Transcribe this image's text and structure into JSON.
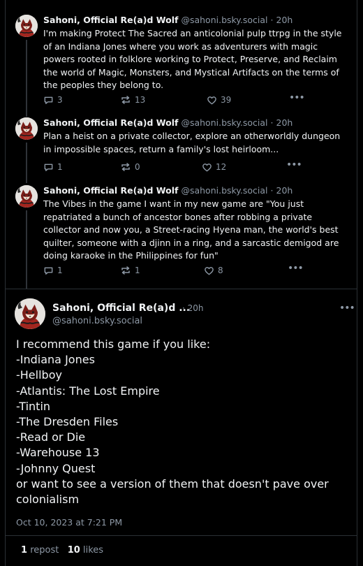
{
  "theme": {
    "background": "#000000",
    "text_primary": "#f1f3f5",
    "text_secondary": "#8d98a5",
    "divider": "#2b3035"
  },
  "thread": [
    {
      "author_name": "Sahoni, Official Re(a)d Wolf",
      "handle": "@sahoni.bsky.social",
      "separator": "·",
      "time": "20h",
      "text": "I'm making Protect The Sacred an anticolonial pulp ttrpg in the style of an Indiana Jones where you work as adventurers with magic powers rooted in folklore working to Protect, Preserve, and Reclaim the world of Magic, Monsters, and Mystical Artifacts on the terms of the peoples they belong to.",
      "replies": "3",
      "reposts": "13",
      "likes": "39"
    },
    {
      "author_name": "Sahoni, Official Re(a)d Wolf",
      "handle": "@sahoni.bsky.social",
      "separator": "·",
      "time": "20h",
      "text": "Plan a heist on a private collector, explore an otherworldly dungeon in impossible spaces, return a family's lost heirloom...",
      "replies": "1",
      "reposts": "0",
      "likes": "12"
    },
    {
      "author_name": "Sahoni, Official Re(a)d Wolf",
      "handle": "@sahoni.bsky.social",
      "separator": "·",
      "time": "20h",
      "text": "The Vibes in the game I want in my new game are \"You just repatriated a bunch of ancestor bones after robbing a private collector and now you, a Street-racing Hyena man, the world's best quilter, someone with a djinn in a ring, and a sarcastic demigod are doing karaoke in the Philippines for fun\"",
      "replies": "1",
      "reposts": "1",
      "likes": "8"
    }
  ],
  "main_post": {
    "author_name": "Sahoni, Official Re(a)d ...",
    "separator": "·",
    "time": "20h",
    "handle": "@sahoni.bsky.social",
    "lines": [
      "I recommend this game if you like:",
      "-Indiana Jones",
      "-Hellboy",
      "-Atlantis: The Lost Empire",
      "-Tintin",
      "-The Dresden Files",
      "-Read or Die",
      "-Warehouse 13",
      "-Johnny Quest",
      "or want to see a version of them that doesn't pave over colonialism"
    ],
    "timestamp": "Oct 10, 2023 at 7:21 PM",
    "repost_count": "1",
    "repost_label": "repost",
    "like_count": "10",
    "like_label": "likes"
  },
  "icons": {
    "reply": "reply-icon",
    "repost": "repost-icon",
    "like": "heart-icon",
    "more": "more-icon"
  }
}
